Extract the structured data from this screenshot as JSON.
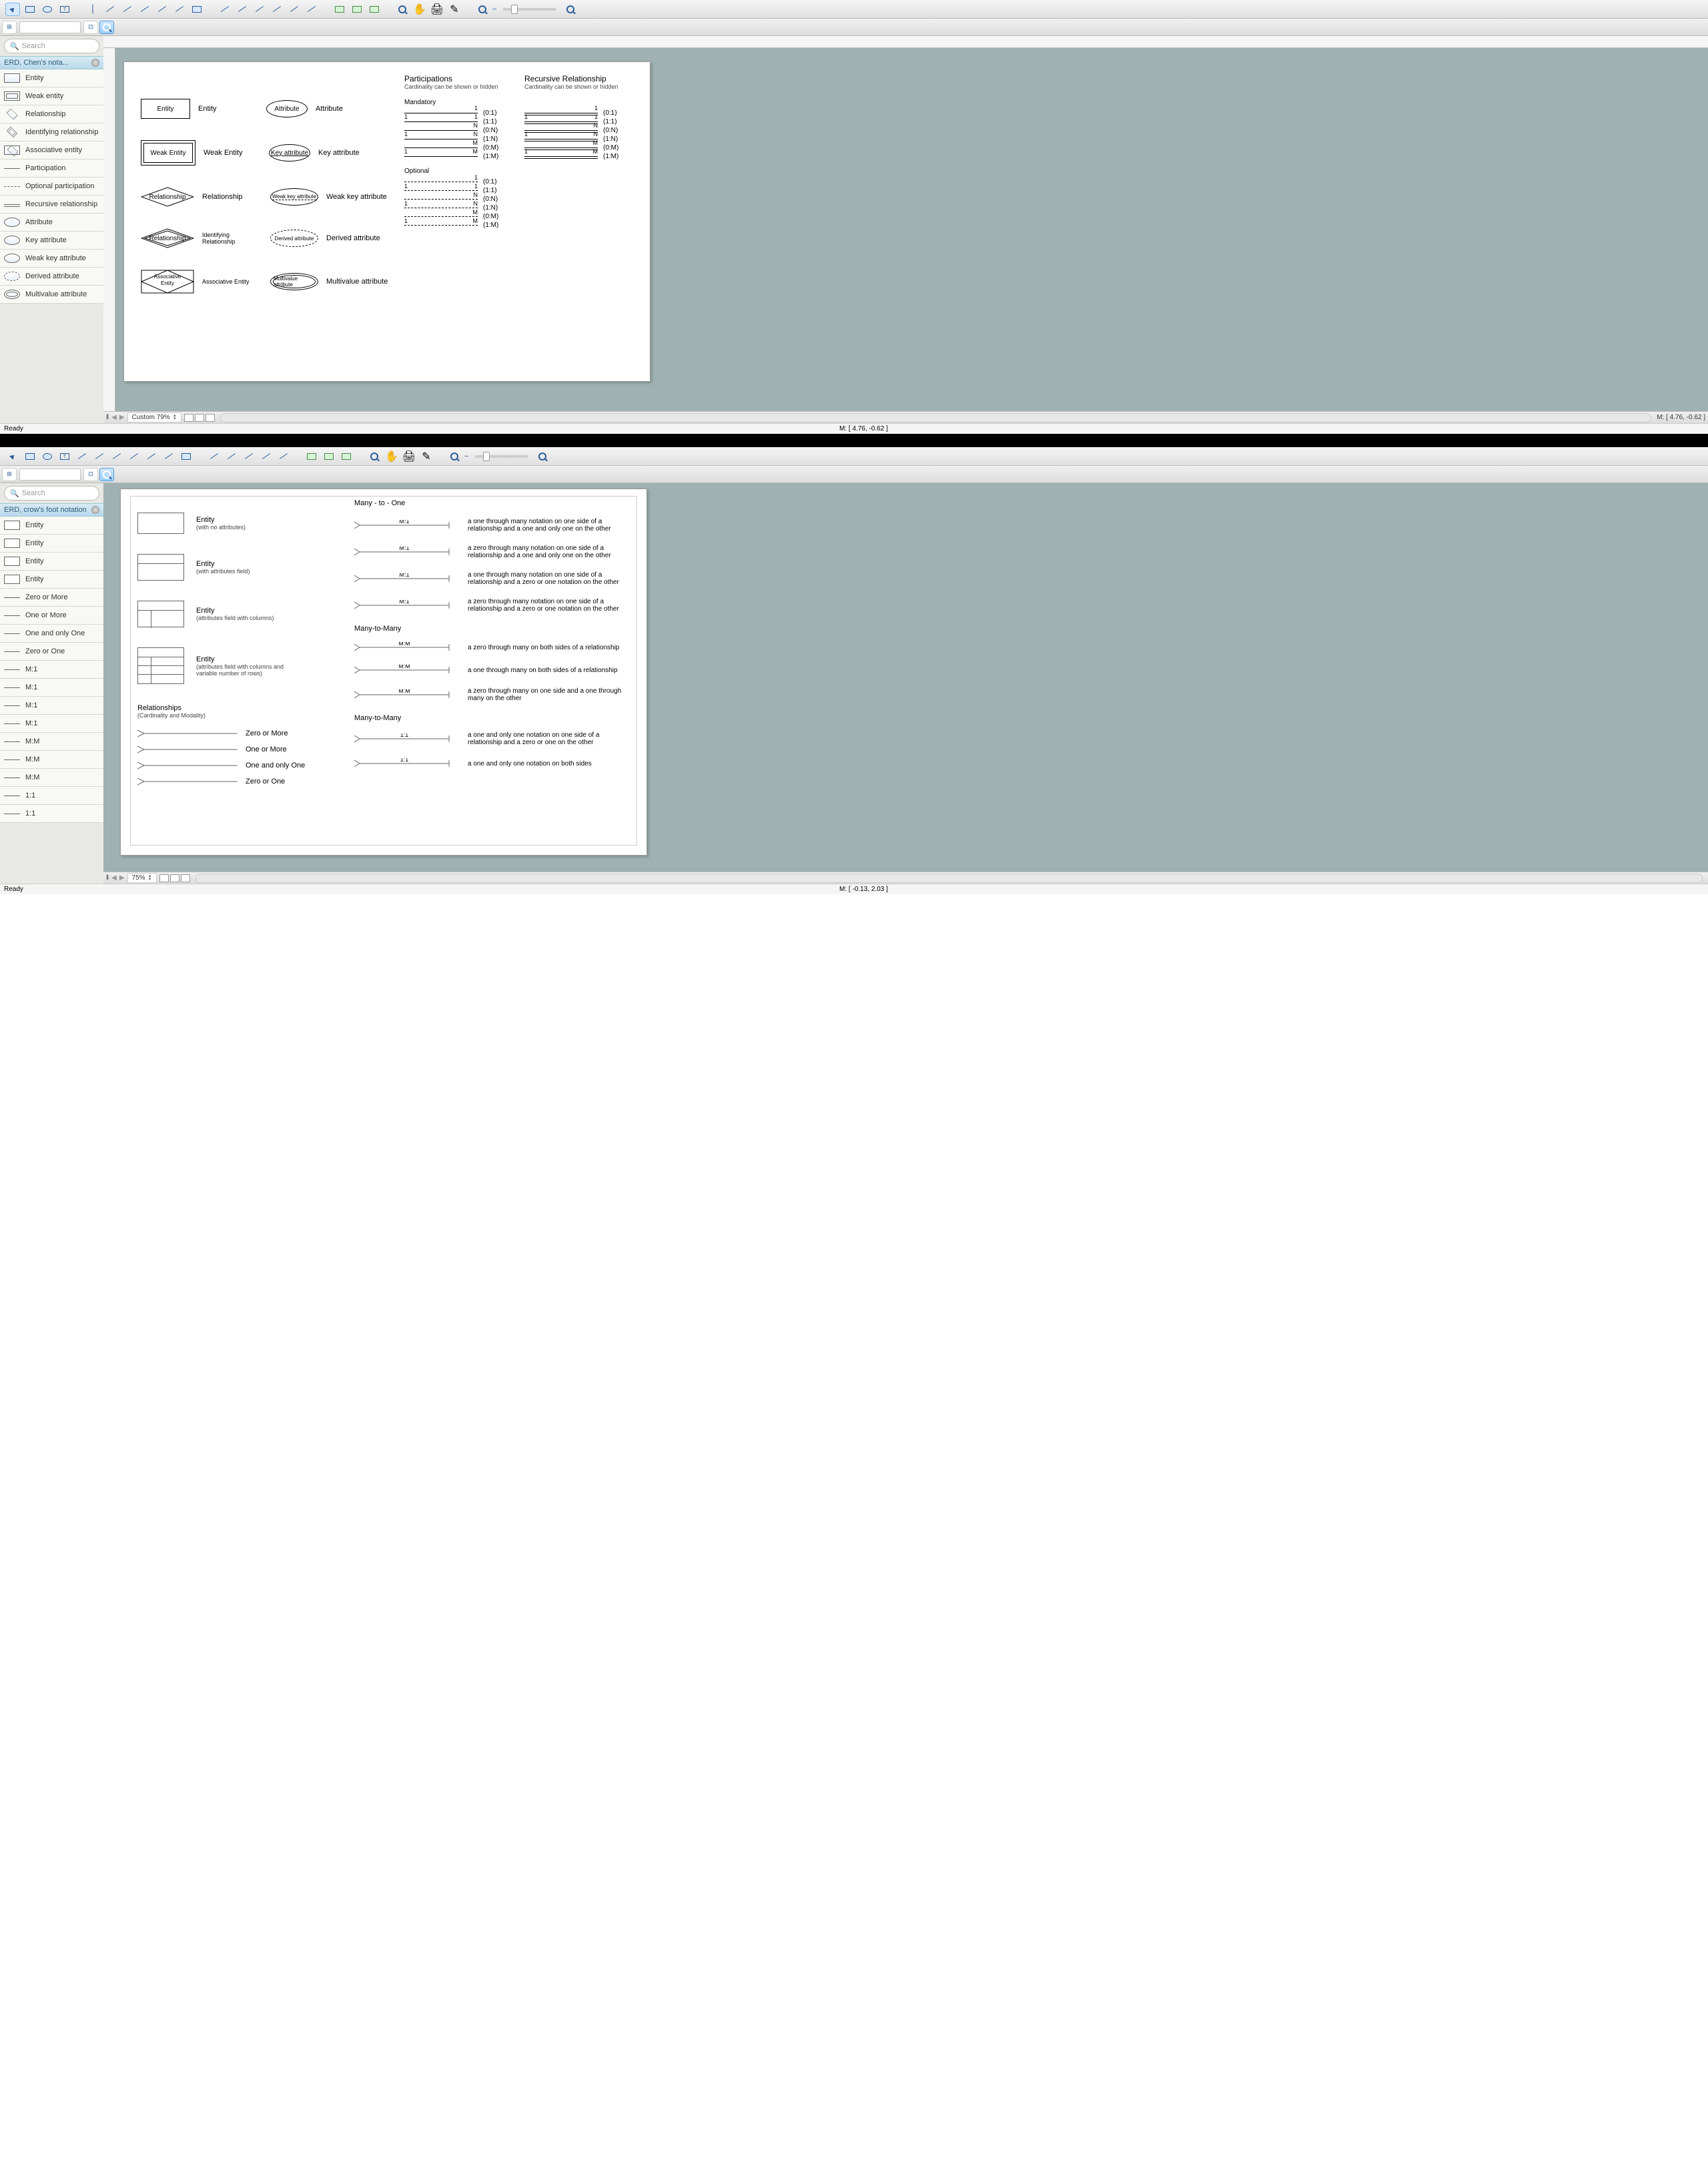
{
  "windows": [
    {
      "search_placeholder": "Search",
      "panel_title": "ERD, Chen's nota...",
      "shapes": [
        "Entity",
        "Weak entity",
        "Relationship",
        "Identifying relationship",
        "Associative entity",
        "Participation",
        "Optional participation",
        "Recursive relationship",
        "Attribute",
        "Key attribute",
        "Weak key attribute",
        "Derived attribute",
        "Multivalue attribute"
      ],
      "zoom_label": "Custom 79%",
      "mouse_coords": "M: [ 4.76, -0.62 ]",
      "status": "Ready",
      "page1": {
        "symbols": [
          {
            "shape_label": "Entity",
            "desc": "Entity",
            "attr_label": "Attribute",
            "attr_desc": "Attribute"
          },
          {
            "shape_label": "Weak Entity",
            "desc": "Weak Entity",
            "attr_label": "Key attribute",
            "attr_desc": "Key attribute"
          },
          {
            "shape_label": "Relationship",
            "desc": "Relationship",
            "attr_label": "Weak key attribute",
            "attr_desc": "Weak key attribute"
          },
          {
            "shape_label": "Relationship",
            "desc": "Identifying Relationship",
            "attr_label": "Derived attribute",
            "attr_desc": "Derived attribute"
          },
          {
            "shape_label": "Associative Entity",
            "desc": "Associative Entity",
            "attr_label": "Multivalue attribute",
            "attr_desc": "Multivalue attribute"
          }
        ],
        "participations_title": "Participations",
        "participations_sub": "Cardinality can be shown or hidden",
        "recursive_title": "Recursive Relationship",
        "recursive_sub": "Cardinality can be shown or hidden",
        "mandatory": "Mandatory",
        "optional": "Optional",
        "mandatory_rows": [
          {
            "l": "",
            "r": "1",
            "c": "(0:1)"
          },
          {
            "l": "1",
            "r": "1",
            "c": "(1:1)"
          },
          {
            "l": "",
            "r": "N",
            "c": "(0:N)"
          },
          {
            "l": "1",
            "r": "N",
            "c": "(1:N)"
          },
          {
            "l": "",
            "r": "M",
            "c": "(0:M)"
          },
          {
            "l": "1",
            "r": "M",
            "c": "(1:M)"
          }
        ],
        "optional_rows": [
          {
            "l": "",
            "r": "1",
            "c": "(0:1)"
          },
          {
            "l": "1",
            "r": "1",
            "c": "(1:1)"
          },
          {
            "l": "",
            "r": "N",
            "c": "(0:N)"
          },
          {
            "l": "1",
            "r": "N",
            "c": "(1:N)"
          },
          {
            "l": "",
            "r": "M",
            "c": "(0:M)"
          },
          {
            "l": "1",
            "r": "M",
            "c": "(1:M)"
          }
        ]
      }
    },
    {
      "search_placeholder": "Search",
      "panel_title": "ERD, crow's foot notation",
      "shapes": [
        "Entity",
        "Entity",
        "Entity",
        "Entity",
        "Zero or More",
        "One or More",
        "One and only One",
        "Zero or One",
        "M:1",
        "M:1",
        "M:1",
        "M:1",
        "M:M",
        "M:M",
        "M:M",
        "1:1",
        "1:1"
      ],
      "zoom_label": "75%",
      "mouse_coords": "M: [ -0.13, 2.03 ]",
      "status": "Ready",
      "page2": {
        "entities": [
          {
            "title": "Entity",
            "sub": "(with no attributes)"
          },
          {
            "title": "Entity",
            "sub": "(with attributes field)"
          },
          {
            "title": "Entity",
            "sub": "(attributes field with columns)"
          },
          {
            "title": "Entity",
            "sub": "(attributes field with columns and variable number of rows)"
          }
        ],
        "rel_title": "Relationships",
        "rel_sub": "(Cardinality and Modality)",
        "simple_rels": [
          "Zero or More",
          "One or More",
          "One and only One",
          "Zero or One"
        ],
        "m1_title": "Many - to - One",
        "m1": [
          {
            "label": "M:1",
            "desc": "a one through many notation on one side of a relationship and a one and only one on the other"
          },
          {
            "label": "M:1",
            "desc": "a zero through many notation on one side of a relationship and a one and only one on the other"
          },
          {
            "label": "M:1",
            "desc": "a one through many notation on one side of a relationship and a zero or one notation on the other"
          },
          {
            "label": "M:1",
            "desc": "a zero through many notation on one side of a relationship and a zero or one notation on the other"
          }
        ],
        "mm_title": "Many-to-Many",
        "mm": [
          {
            "label": "M:M",
            "desc": "a zero through many on both sides of a relationship"
          },
          {
            "label": "M:M",
            "desc": "a one through many on both sides of a relationship"
          },
          {
            "label": "M:M",
            "desc": "a zero through many on one side and a one through many on the other"
          }
        ],
        "mm2_title": "Many-to-Many",
        "oo": [
          {
            "label": "1:1",
            "desc": "a one and only one notation on one side of a relationship and a zero or one on the other"
          },
          {
            "label": "1:1",
            "desc": "a one and only one notation on both sides"
          }
        ]
      }
    }
  ]
}
